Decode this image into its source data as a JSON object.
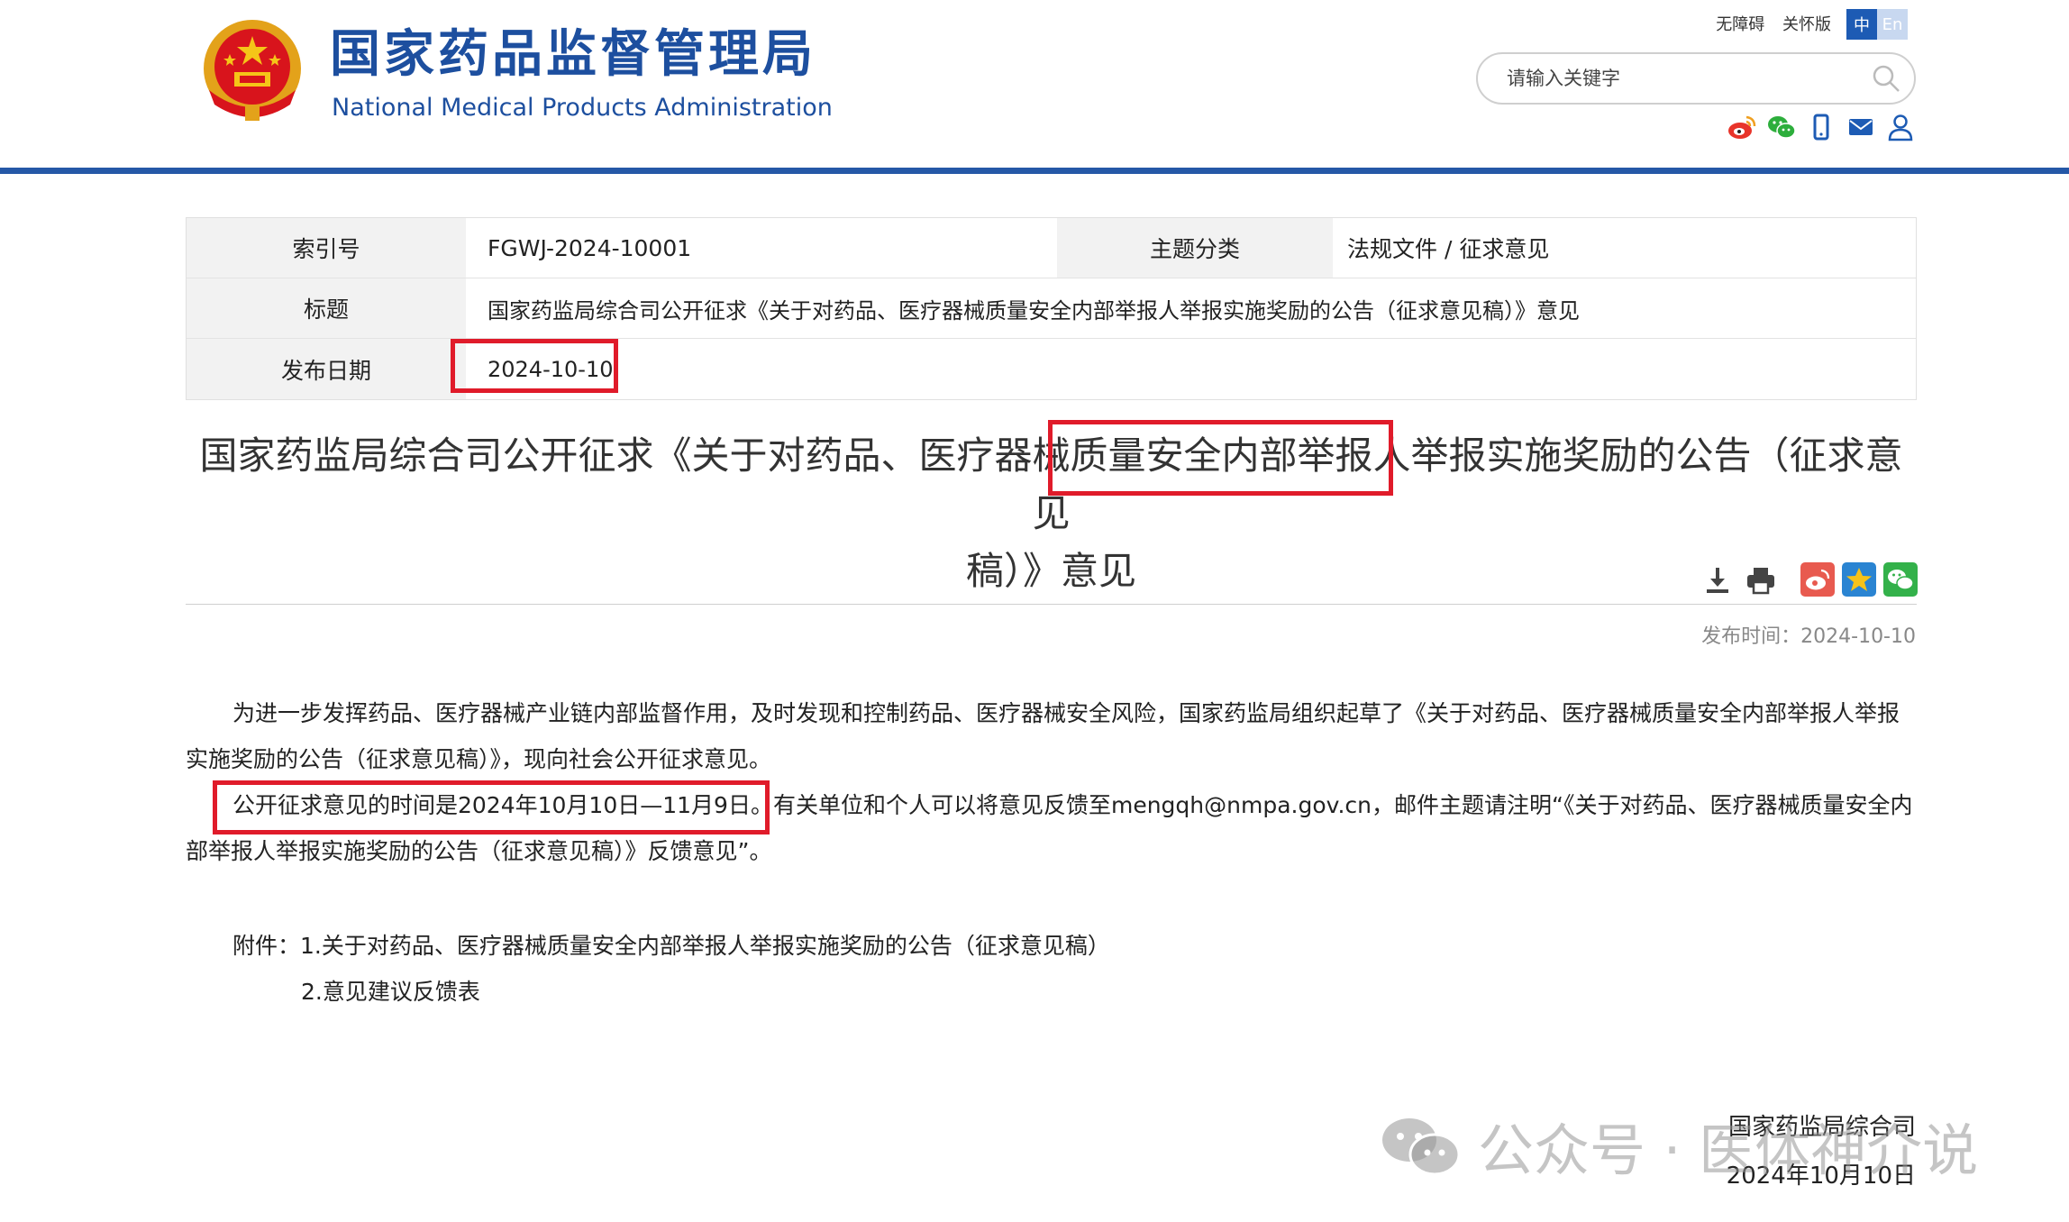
{
  "header": {
    "title_cn": "国家药品监督管理局",
    "title_en": "National Medical Products Administration",
    "util_links": [
      "无障碍",
      "关怀版"
    ],
    "lang": {
      "cn": "中",
      "en": "En"
    },
    "search_placeholder": "请输入关键字",
    "brand_color": "#1d4f9f",
    "social_icons": [
      "weibo-icon",
      "wechat-icon",
      "mobile-icon",
      "mail-icon",
      "user-icon"
    ]
  },
  "meta": {
    "index_label": "索引号",
    "index_value": "FGWJ-2024-10001",
    "category_label": "主题分类",
    "category_value": "法规文件 / 征求意见",
    "title_label": "标题",
    "title_value": "国家药监局综合司公开征求《关于对药品、医疗器械质量安全内部举报人举报实施奖励的公告（征求意见稿）》意见",
    "date_label": "发布日期",
    "date_value": "2024-10-10"
  },
  "article": {
    "title_line1": "国家药监局综合司公开征求《关于对药品、医疗器械质量安全内部举报人举报实施奖励的公告（征求意见",
    "title_line2": "稿）》意见",
    "publish_time": "发布时间：2024-10-10",
    "para1": "为进一步发挥药品、医疗器械产业链内部监督作用，及时发现和控制药品、医疗器械安全风险，国家药监局组织起草了《关于对药品、医疗器械质量安全内部举报人举报实施奖励的公告（征求意见稿）》，现向社会公开征求意见。",
    "para2": "公开征求意见的时间是2024年10月10日—11月9日。有关单位和个人可以将意见反馈至mengqh@nmpa.gov.cn，邮件主题请注明“《关于对药品、医疗器械质量安全内部举报人举报实施奖励的公告（征求意见稿）》反馈意见”。",
    "attach_label": "附件：",
    "attach_1": "1.关于对药品、医疗器械质量安全内部举报人举报实施奖励的公告（征求意见稿）",
    "attach_2": "2.意见建议反馈表",
    "sign_org": "国家药监局综合司",
    "sign_date": "2024年10月10日"
  },
  "highlight_color": "#e01b2a",
  "watermark": {
    "text": "公众号 · 医体神介说"
  }
}
